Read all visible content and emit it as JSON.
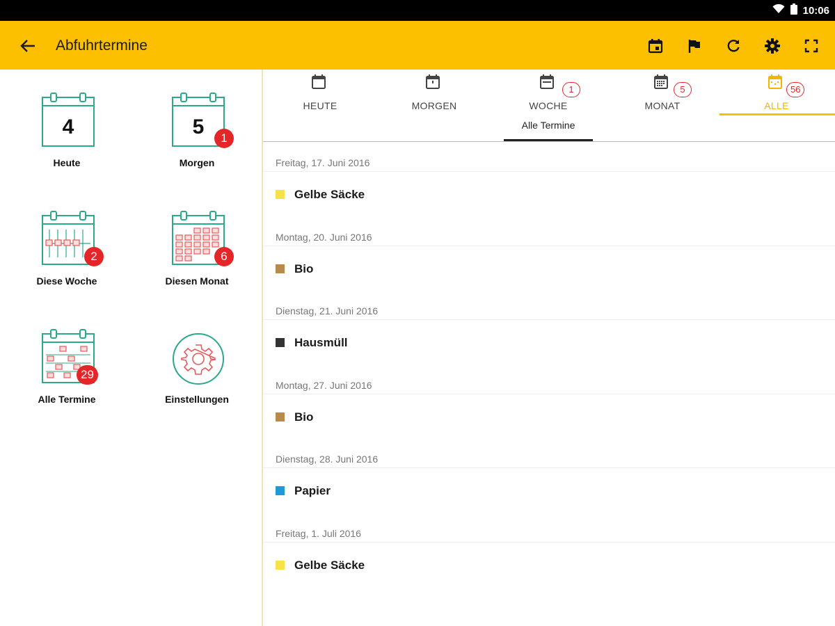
{
  "status_bar": {
    "time": "10:06"
  },
  "app_bar": {
    "title": "Abfuhrtermine",
    "actions": [
      "calendar-event-icon",
      "flag-icon",
      "refresh-icon",
      "settings-icon",
      "fullscreen-icon"
    ]
  },
  "left_menu": {
    "tiles": [
      {
        "label": "Heute",
        "number": "4",
        "badge": ""
      },
      {
        "label": "Morgen",
        "number": "5",
        "badge": "1"
      },
      {
        "label": "Diese Woche",
        "badge": "2"
      },
      {
        "label": "Diesen Monat",
        "badge": "6"
      },
      {
        "label": "Alle Termine",
        "badge": "29"
      },
      {
        "label": "Einstellungen",
        "badge": ""
      }
    ]
  },
  "tabs": [
    {
      "label": "HEUTE",
      "badge": ""
    },
    {
      "label": "MORGEN",
      "badge": ""
    },
    {
      "label": "WOCHE",
      "badge": "1"
    },
    {
      "label": "MONAT",
      "badge": "5"
    },
    {
      "label": "ALLE",
      "badge": "56",
      "active": true
    }
  ],
  "subtab": {
    "label": "Alle Termine"
  },
  "colors": {
    "accent": "#fcc000",
    "badge_red": "#e52628",
    "teal": "#2aa98b",
    "gelbe_saecke": "#f7e24a",
    "bio": "#b98a4d",
    "hausmuell": "#333333",
    "papier": "#1e9ad6"
  },
  "schedule": [
    {
      "date": "Freitag, 17. Juni 2016",
      "name": "Gelbe Säcke",
      "color": "#f7e24a"
    },
    {
      "date": "Montag, 20. Juni 2016",
      "name": "Bio",
      "color": "#b98a4d"
    },
    {
      "date": "Dienstag, 21. Juni 2016",
      "name": "Hausmüll",
      "color": "#333333"
    },
    {
      "date": "Montag, 27. Juni 2016",
      "name": "Bio",
      "color": "#b98a4d"
    },
    {
      "date": "Dienstag, 28. Juni 2016",
      "name": "Papier",
      "color": "#1e9ad6"
    },
    {
      "date": "Freitag, 1. Juli 2016",
      "name": "Gelbe Säcke",
      "color": "#f7e24a"
    }
  ]
}
